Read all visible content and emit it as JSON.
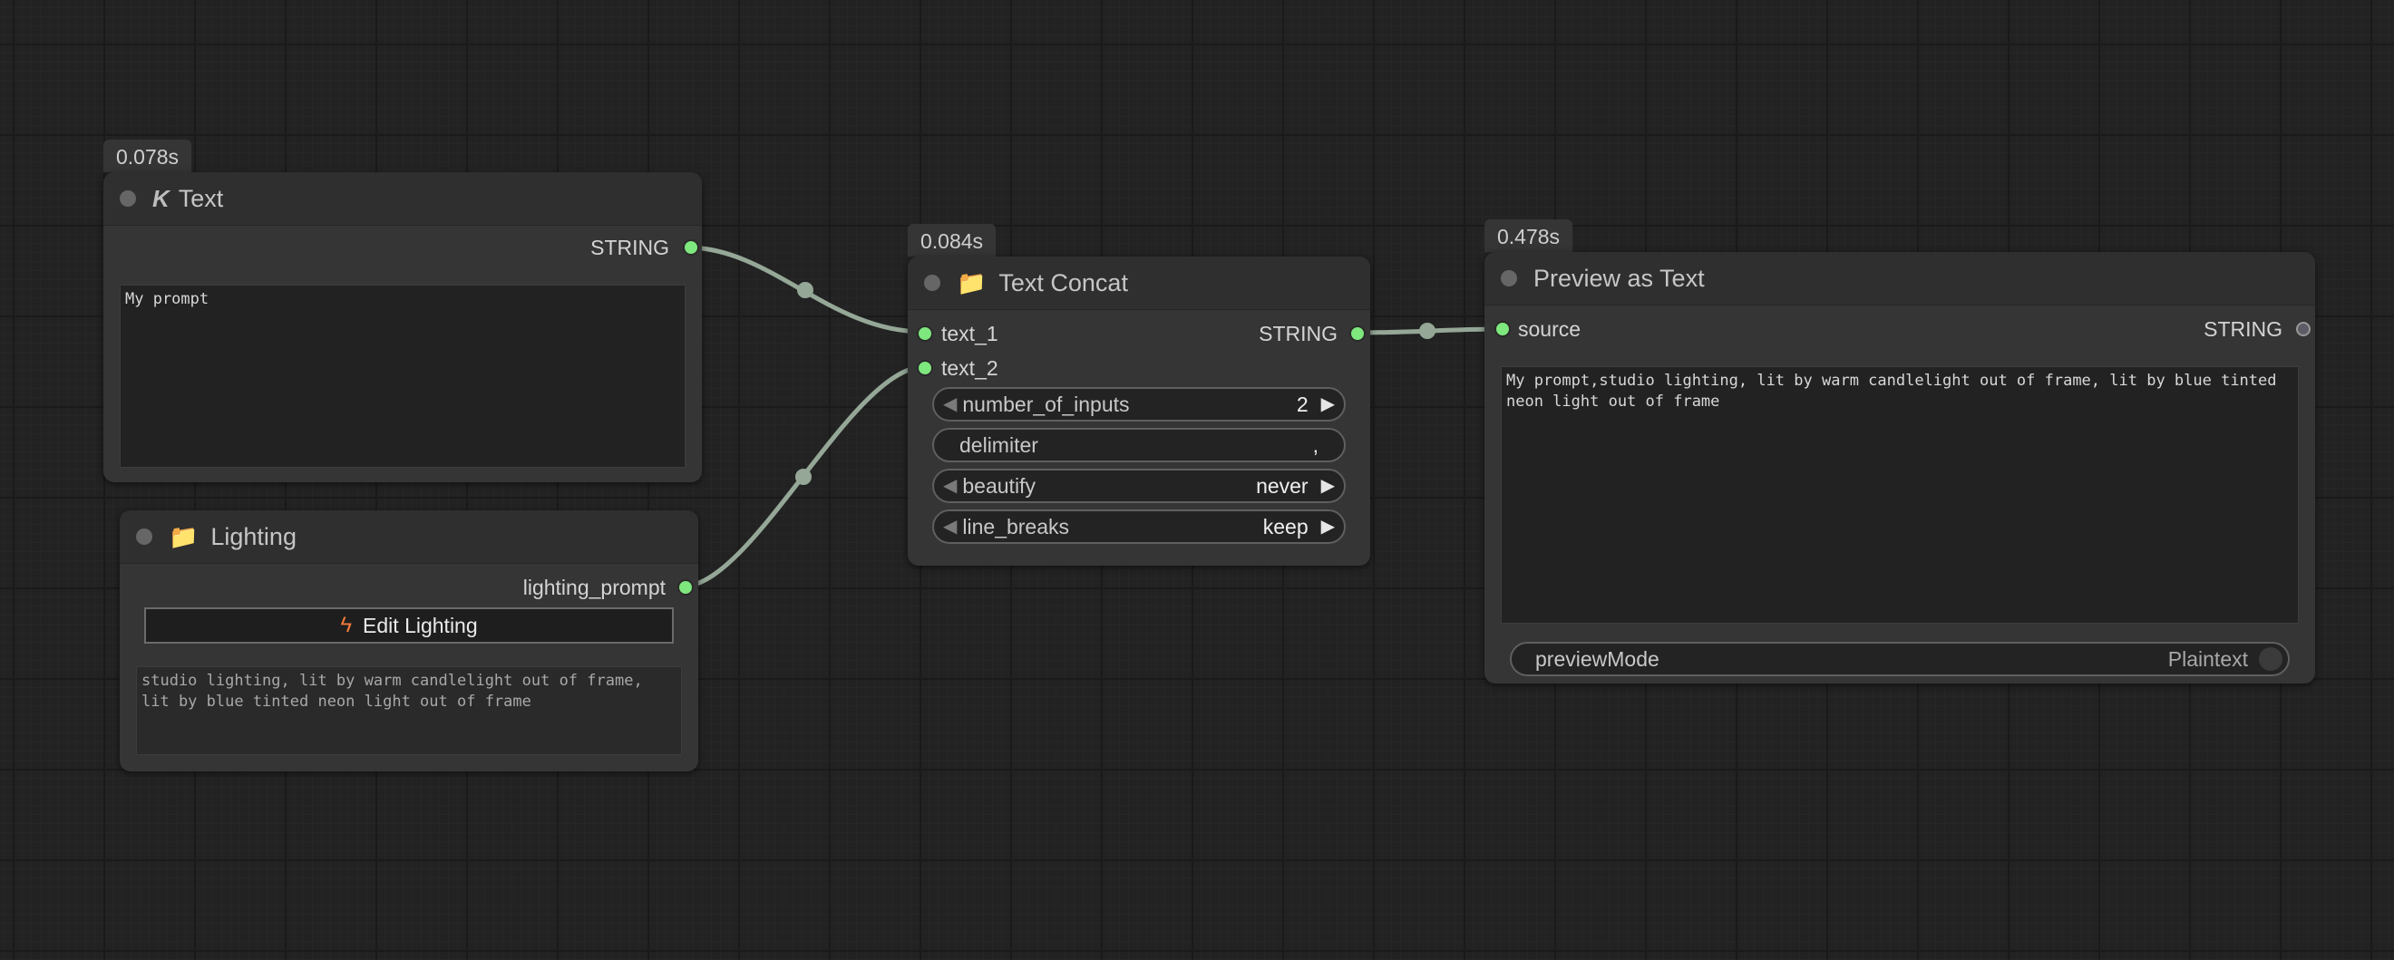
{
  "nodes": {
    "text_node": {
      "timing": "0.078s",
      "title": "Text",
      "output_label": "STRING",
      "text_value": "My prompt"
    },
    "lighting_node": {
      "title": "Lighting",
      "output_label": "lighting_prompt",
      "button_label": "Edit Lighting",
      "text_value": "studio lighting, lit by warm candlelight out of frame,\nlit by blue tinted neon light out of frame"
    },
    "concat_node": {
      "timing": "0.084s",
      "title": "Text Concat",
      "inputs": [
        "text_1",
        "text_2"
      ],
      "output_label": "STRING",
      "widgets": [
        {
          "label": "number_of_inputs",
          "value": "2"
        },
        {
          "label": "delimiter",
          "value": ","
        },
        {
          "label": "beautify",
          "value": "never"
        },
        {
          "label": "line_breaks",
          "value": "keep"
        }
      ]
    },
    "preview_node": {
      "timing": "0.478s",
      "title": "Preview as Text",
      "input_label": "source",
      "output_label": "STRING",
      "preview_text": "My prompt,studio lighting, lit by warm candlelight out of frame, lit by blue tinted\nneon light out of frame",
      "preview_mode_label": "previewMode",
      "preview_mode_value": "Plaintext"
    }
  },
  "colors": {
    "canvas": "#222222",
    "node_body": "#353535",
    "slot_connected": "#7ee77e",
    "link": "#95a797"
  },
  "icons": {
    "text_node": "k-logo-icon",
    "lighting_node": "folder-icon",
    "concat_node": "folder-icon",
    "button": "lightning-bolt-icon"
  }
}
